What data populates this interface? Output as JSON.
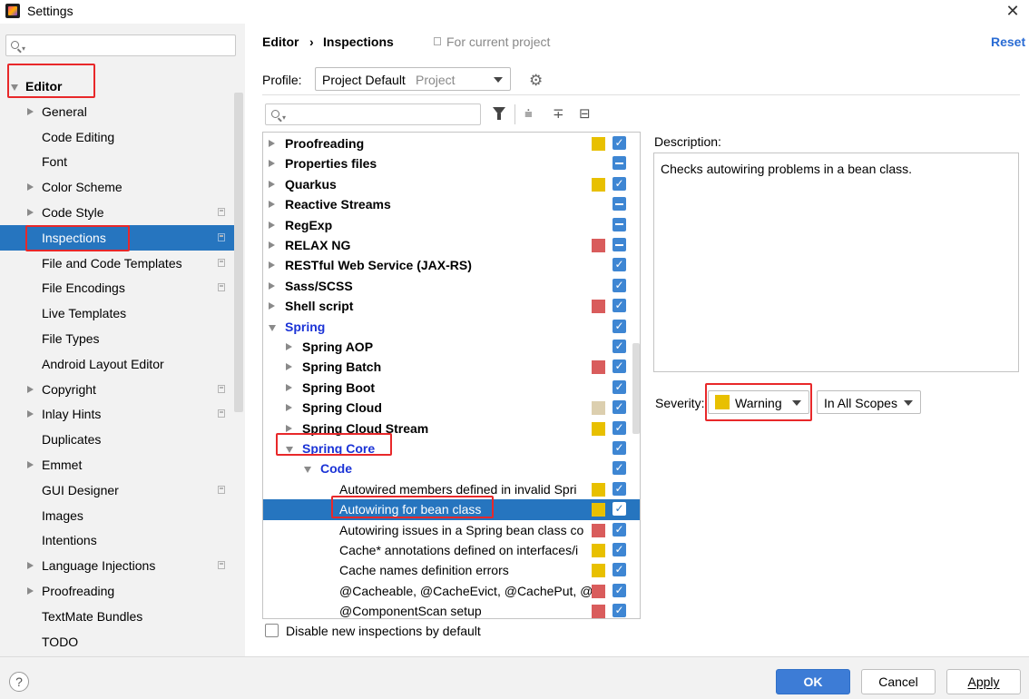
{
  "window": {
    "title": "Settings",
    "close_label": "✕"
  },
  "sidebar": {
    "search_placeholder": "",
    "items": [
      {
        "label": "Editor",
        "arrow": "down",
        "bold": true,
        "indent": 28,
        "project": false
      },
      {
        "label": "General",
        "arrow": "right",
        "indent": 46,
        "project": false
      },
      {
        "label": "Code Editing",
        "arrow": null,
        "indent": 46,
        "project": false
      },
      {
        "label": "Font",
        "arrow": null,
        "indent": 46,
        "project": false
      },
      {
        "label": "Color Scheme",
        "arrow": "right",
        "indent": 46,
        "project": false
      },
      {
        "label": "Code Style",
        "arrow": "right",
        "indent": 46,
        "project": true
      },
      {
        "label": "Inspections",
        "arrow": null,
        "indent": 46,
        "project": true,
        "selected": true
      },
      {
        "label": "File and Code Templates",
        "arrow": null,
        "indent": 46,
        "project": true
      },
      {
        "label": "File Encodings",
        "arrow": null,
        "indent": 46,
        "project": true
      },
      {
        "label": "Live Templates",
        "arrow": null,
        "indent": 46,
        "project": false
      },
      {
        "label": "File Types",
        "arrow": null,
        "indent": 46,
        "project": false
      },
      {
        "label": "Android Layout Editor",
        "arrow": null,
        "indent": 46,
        "project": false
      },
      {
        "label": "Copyright",
        "arrow": "right",
        "indent": 46,
        "project": true
      },
      {
        "label": "Inlay Hints",
        "arrow": "right",
        "indent": 46,
        "project": true
      },
      {
        "label": "Duplicates",
        "arrow": null,
        "indent": 46,
        "project": false
      },
      {
        "label": "Emmet",
        "arrow": "right",
        "indent": 46,
        "project": false
      },
      {
        "label": "GUI Designer",
        "arrow": null,
        "indent": 46,
        "project": true
      },
      {
        "label": "Images",
        "arrow": null,
        "indent": 46,
        "project": false
      },
      {
        "label": "Intentions",
        "arrow": null,
        "indent": 46,
        "project": false
      },
      {
        "label": "Language Injections",
        "arrow": "right",
        "indent": 46,
        "project": true
      },
      {
        "label": "Proofreading",
        "arrow": "right",
        "indent": 46,
        "project": false
      },
      {
        "label": "TextMate Bundles",
        "arrow": null,
        "indent": 46,
        "project": false
      },
      {
        "label": "TODO",
        "arrow": null,
        "indent": 46,
        "project": false
      }
    ]
  },
  "header": {
    "breadcrumb_editor": "Editor",
    "breadcrumb_sep": "›",
    "breadcrumb_current": "Inspections",
    "for_project": "For current project",
    "reset_label": "Reset"
  },
  "profile": {
    "label": "Profile:",
    "value": "Project Default",
    "scope": "Project"
  },
  "inspections": {
    "rows": [
      {
        "label": "Proofreading",
        "level": 0,
        "arrow": "right",
        "bold": true,
        "blue": false,
        "severity": "#e8c000",
        "check": "checked"
      },
      {
        "label": "Properties files",
        "level": 0,
        "arrow": "right",
        "bold": true,
        "blue": false,
        "severity": null,
        "check": "partial"
      },
      {
        "label": "Quarkus",
        "level": 0,
        "arrow": "right",
        "bold": true,
        "blue": false,
        "severity": "#e8c000",
        "check": "checked"
      },
      {
        "label": "Reactive Streams",
        "level": 0,
        "arrow": "right",
        "bold": true,
        "blue": false,
        "severity": null,
        "check": "partial"
      },
      {
        "label": "RegExp",
        "level": 0,
        "arrow": "right",
        "bold": true,
        "blue": false,
        "severity": null,
        "check": "partial"
      },
      {
        "label": "RELAX NG",
        "level": 0,
        "arrow": "right",
        "bold": true,
        "blue": false,
        "severity": "#d95c5c",
        "check": "partial"
      },
      {
        "label": "RESTful Web Service (JAX-RS)",
        "level": 0,
        "arrow": "right",
        "bold": true,
        "blue": false,
        "severity": null,
        "check": "checked"
      },
      {
        "label": "Sass/SCSS",
        "level": 0,
        "arrow": "right",
        "bold": true,
        "blue": false,
        "severity": null,
        "check": "checked"
      },
      {
        "label": "Shell script",
        "level": 0,
        "arrow": "right",
        "bold": true,
        "blue": false,
        "severity": "#d95c5c",
        "check": "checked"
      },
      {
        "label": "Spring",
        "level": 0,
        "arrow": "down",
        "bold": true,
        "blue": true,
        "severity": null,
        "check": "checked"
      },
      {
        "label": "Spring AOP",
        "level": 1,
        "arrow": "right",
        "bold": true,
        "blue": false,
        "severity": null,
        "check": "checked"
      },
      {
        "label": "Spring Batch",
        "level": 1,
        "arrow": "right",
        "bold": true,
        "blue": false,
        "severity": "#d95c5c",
        "check": "checked"
      },
      {
        "label": "Spring Boot",
        "level": 1,
        "arrow": "right",
        "bold": true,
        "blue": false,
        "severity": null,
        "check": "checked"
      },
      {
        "label": "Spring Cloud",
        "level": 1,
        "arrow": "right",
        "bold": true,
        "blue": false,
        "severity": "#dccfaf",
        "check": "checked"
      },
      {
        "label": "Spring Cloud Stream",
        "level": 1,
        "arrow": "right",
        "bold": true,
        "blue": false,
        "severity": "#e8c000",
        "check": "checked"
      },
      {
        "label": "Spring Core",
        "level": 1,
        "arrow": "down",
        "bold": true,
        "blue": true,
        "underline": true,
        "severity": null,
        "check": "checked"
      },
      {
        "label": "Code",
        "level": 2,
        "arrow": "down",
        "bold": true,
        "blue": true,
        "severity": null,
        "check": "checked"
      },
      {
        "label": "Autowired members defined in invalid Spri",
        "level": 3,
        "arrow": null,
        "bold": false,
        "blue": false,
        "severity": "#e8c000",
        "check": "checked"
      },
      {
        "label": "Autowiring for bean class",
        "level": 3,
        "arrow": null,
        "bold": false,
        "blue": false,
        "severity": "#e8c000",
        "check": "checked",
        "selected": true
      },
      {
        "label": "Autowiring issues in a Spring bean class co",
        "level": 3,
        "arrow": null,
        "bold": false,
        "blue": false,
        "severity": "#d95c5c",
        "check": "checked"
      },
      {
        "label": "Cache* annotations defined on interfaces/i",
        "level": 3,
        "arrow": null,
        "bold": false,
        "blue": false,
        "severity": "#e8c000",
        "check": "checked"
      },
      {
        "label": "Cache names definition errors",
        "level": 3,
        "arrow": null,
        "bold": false,
        "blue": false,
        "severity": "#e8c000",
        "check": "checked"
      },
      {
        "label": "@Cacheable, @CacheEvict, @CachePut, @",
        "level": 3,
        "arrow": null,
        "bold": false,
        "blue": false,
        "severity": "#d95c5c",
        "check": "checked"
      },
      {
        "label": "@ComponentScan setup",
        "level": 3,
        "arrow": null,
        "bold": false,
        "blue": false,
        "severity": "#d95c5c",
        "check": "checked"
      }
    ]
  },
  "description": {
    "label": "Description:",
    "text": "Checks autowiring problems in a bean class."
  },
  "severity": {
    "label": "Severity:",
    "value": "Warning",
    "color": "#e8c000",
    "scope": "In All Scopes"
  },
  "disable_new_label": "Disable new inspections by default",
  "buttons": {
    "help": "?",
    "ok": "OK",
    "cancel": "Cancel",
    "apply": "Apply"
  },
  "colors": {
    "selection": "#2675bf",
    "accent": "#3d7cd6",
    "highlight": "#e8282a"
  }
}
